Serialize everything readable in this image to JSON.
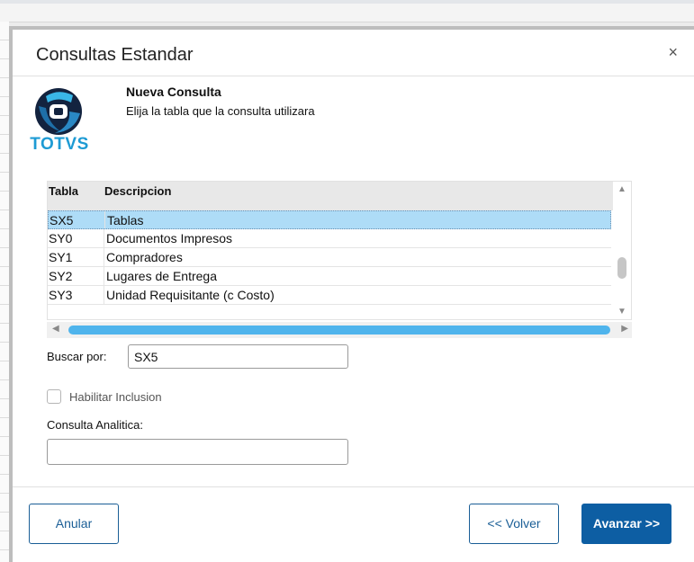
{
  "dialog": {
    "title": "Consultas Estandar",
    "close_label": "×"
  },
  "header": {
    "logo_text": "TOTVS",
    "title": "Nueva Consulta",
    "subtitle": "Elija la tabla que la consulta utilizara"
  },
  "table": {
    "columns": [
      "Tabla",
      "Descripcion"
    ],
    "rows": [
      {
        "tabla": "SX5",
        "descripcion": "Tablas",
        "selected": true
      },
      {
        "tabla": "SY0",
        "descripcion": "Documentos Impresos"
      },
      {
        "tabla": "SY1",
        "descripcion": "Compradores"
      },
      {
        "tabla": "SY2",
        "descripcion": "Lugares de Entrega"
      },
      {
        "tabla": "SY3",
        "descripcion": "Unidad Requisitante (c Costo)"
      }
    ]
  },
  "search": {
    "label": "Buscar por:",
    "value": "SX5"
  },
  "habilitar": {
    "label": "Habilitar Inclusion",
    "checked": false
  },
  "analitica": {
    "label": "Consulta Analitica:",
    "value": ""
  },
  "buttons": {
    "anular": "Anular",
    "volver": "<< Volver",
    "avanzar": "Avanzar >>"
  },
  "colors": {
    "accent": "#0d5ea3",
    "selection": "#aedcf7",
    "scroll_thumb": "#4fb4ec"
  }
}
